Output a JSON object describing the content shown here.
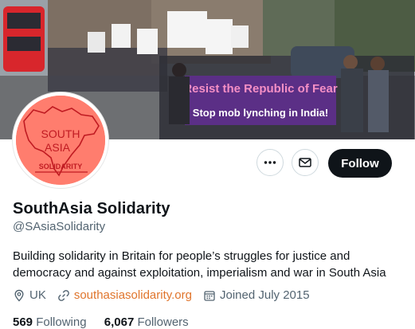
{
  "banner": {
    "placard_line_1": "Resist the Republic of Fear",
    "placard_line_2": "Stop mob lynching in India!",
    "banner_colors": {
      "placard": "#5b2f86",
      "placard_text": "#f58fc5",
      "bus": "#d8262c"
    }
  },
  "avatar": {
    "line_1": "SOUTH",
    "line_2": "ASIA",
    "line_3": "SOLIDARITY",
    "bg_color": "#ff7d6e",
    "ink_color": "#c01b22"
  },
  "actions": {
    "more_icon": "more-horizontal-icon",
    "message_icon": "envelope-icon",
    "follow_label": "Follow"
  },
  "profile": {
    "name": "SouthAsia Solidarity",
    "handle": "@SAsiaSolidarity",
    "bio": "Building solidarity in Britain for people’s struggles for justice and democracy and against exploitation, imperialism and war in South Asia",
    "location": "UK",
    "website": "southasiasolidarity.org",
    "joined": "Joined July 2015",
    "link_color": "#e0752c"
  },
  "stats": {
    "following_count": "569",
    "following_label": "Following",
    "followers_count": "6,067",
    "followers_label": "Followers"
  }
}
